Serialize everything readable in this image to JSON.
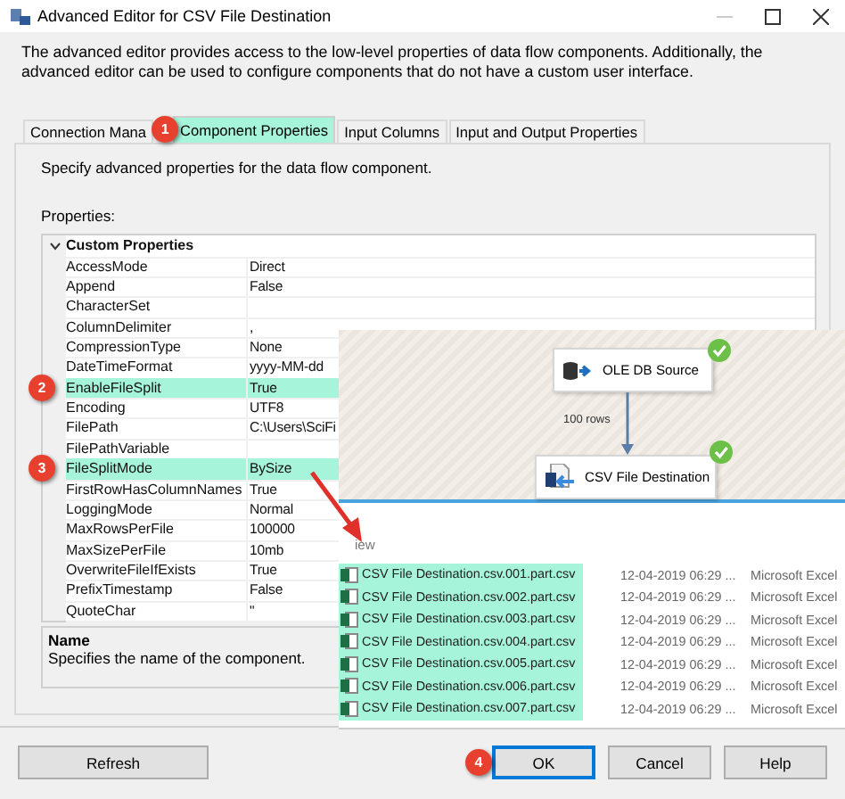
{
  "window": {
    "title": "Advanced Editor for CSV File Destination"
  },
  "description": "The advanced editor provides access to the low-level properties of data flow components. Additionally, the advanced editor can be used to configure components that do not have a custom user interface.",
  "tabs": [
    {
      "label": "Connection Mana",
      "selected": false
    },
    {
      "label": "Component Properties",
      "selected": true,
      "callout": "1"
    },
    {
      "label": "Input Columns",
      "selected": false
    },
    {
      "label": "Input and Output Properties",
      "selected": false
    }
  ],
  "panel": {
    "instruction": "Specify advanced properties for the data flow component.",
    "properties_label": "Properties:"
  },
  "grid": {
    "category": {
      "label": "Custom Properties",
      "expanded": true
    },
    "rows": [
      {
        "name": "AccessMode",
        "value": "Direct",
        "highlighted": false
      },
      {
        "name": "Append",
        "value": "False",
        "highlighted": false
      },
      {
        "name": "CharacterSet",
        "value": "",
        "highlighted": false
      },
      {
        "name": "ColumnDelimiter",
        "value": ",",
        "highlighted": false
      },
      {
        "name": "CompressionType",
        "value": "None",
        "highlighted": false
      },
      {
        "name": "DateTimeFormat",
        "value": "yyyy-MM-dd",
        "highlighted": false
      },
      {
        "name": "EnableFileSplit",
        "value": "True",
        "highlighted": true,
        "callout": "2"
      },
      {
        "name": "Encoding",
        "value": "UTF8",
        "highlighted": false
      },
      {
        "name": "FilePath",
        "value": "C:\\Users\\SciFi",
        "highlighted": false
      },
      {
        "name": "FilePathVariable",
        "value": "",
        "highlighted": false
      },
      {
        "name": "FileSplitMode",
        "value": "BySize",
        "highlighted": true,
        "callout": "3"
      },
      {
        "name": "FirstRowHasColumnNames",
        "value": "True",
        "highlighted": false
      },
      {
        "name": "LoggingMode",
        "value": "Normal",
        "highlighted": false
      },
      {
        "name": "MaxRowsPerFile",
        "value": "100000",
        "highlighted": false
      },
      {
        "name": "MaxSizePerFile",
        "value": "10mb",
        "highlighted": false
      },
      {
        "name": "OverwriteFileIfExists",
        "value": "True",
        "highlighted": false
      },
      {
        "name": "PrefixTimestamp",
        "value": "False",
        "highlighted": false
      },
      {
        "name": "QuoteChar",
        "value": "\"",
        "highlighted": false
      }
    ]
  },
  "help": {
    "title": "Name",
    "text": "Specifies the name of the component."
  },
  "buttons": [
    {
      "label": "Refresh",
      "kind": "left",
      "default": false
    },
    {
      "label": "OK",
      "kind": "right",
      "default": true,
      "callout": "4"
    },
    {
      "label": "Cancel",
      "kind": "right",
      "default": false
    },
    {
      "label": "Help",
      "kind": "right",
      "default": false
    }
  ],
  "data_flow": {
    "nodes": [
      {
        "label": "OLE DB Source",
        "kind": "source",
        "valid": true
      },
      {
        "label": "CSV File Destination",
        "kind": "destination",
        "valid": true
      }
    ],
    "connector_label": "100 rows"
  },
  "file_list": {
    "column_header": "iew",
    "files": [
      {
        "name": "CSV File Destination.csv.001.part.csv",
        "date": "12-04-2019 06:29 ...",
        "type": "Microsoft Excel",
        "highlighted": true
      },
      {
        "name": "CSV File Destination.csv.002.part.csv",
        "date": "12-04-2019 06:29 ...",
        "type": "Microsoft Excel",
        "highlighted": true
      },
      {
        "name": "CSV File Destination.csv.003.part.csv",
        "date": "12-04-2019 06:29 ...",
        "type": "Microsoft Excel",
        "highlighted": true
      },
      {
        "name": "CSV File Destination.csv.004.part.csv",
        "date": "12-04-2019 06:29 ...",
        "type": "Microsoft Excel",
        "highlighted": true
      },
      {
        "name": "CSV File Destination.csv.005.part.csv",
        "date": "12-04-2019 06:29 ...",
        "type": "Microsoft Excel",
        "highlighted": true
      },
      {
        "name": "CSV File Destination.csv.006.part.csv",
        "date": "12-04-2019 06:29 ...",
        "type": "Microsoft Excel",
        "highlighted": true
      },
      {
        "name": "CSV File Destination.csv.007.part.csv",
        "date": "12-04-2019 06:29 ...",
        "type": "Microsoft Excel",
        "highlighted": true
      }
    ]
  }
}
